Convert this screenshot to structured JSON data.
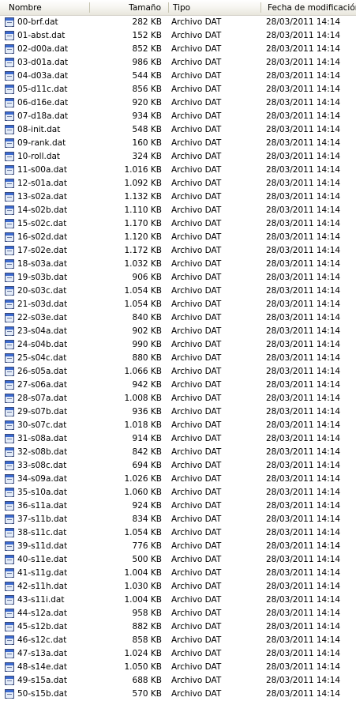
{
  "columns": {
    "name": "Nombre",
    "size": "Tamaño",
    "type": "Tipo",
    "modified": "Fecha de modificación"
  },
  "files": [
    {
      "name": "00-brf.dat",
      "size": "282 KB",
      "type": "Archivo DAT",
      "modified": "28/03/2011 14:14"
    },
    {
      "name": "01-abst.dat",
      "size": "152 KB",
      "type": "Archivo DAT",
      "modified": "28/03/2011 14:14"
    },
    {
      "name": "02-d00a.dat",
      "size": "852 KB",
      "type": "Archivo DAT",
      "modified": "28/03/2011 14:14"
    },
    {
      "name": "03-d01a.dat",
      "size": "986 KB",
      "type": "Archivo DAT",
      "modified": "28/03/2011 14:14"
    },
    {
      "name": "04-d03a.dat",
      "size": "544 KB",
      "type": "Archivo DAT",
      "modified": "28/03/2011 14:14"
    },
    {
      "name": "05-d11c.dat",
      "size": "856 KB",
      "type": "Archivo DAT",
      "modified": "28/03/2011 14:14"
    },
    {
      "name": "06-d16e.dat",
      "size": "920 KB",
      "type": "Archivo DAT",
      "modified": "28/03/2011 14:14"
    },
    {
      "name": "07-d18a.dat",
      "size": "934 KB",
      "type": "Archivo DAT",
      "modified": "28/03/2011 14:14"
    },
    {
      "name": "08-init.dat",
      "size": "548 KB",
      "type": "Archivo DAT",
      "modified": "28/03/2011 14:14"
    },
    {
      "name": "09-rank.dat",
      "size": "160 KB",
      "type": "Archivo DAT",
      "modified": "28/03/2011 14:14"
    },
    {
      "name": "10-roll.dat",
      "size": "324 KB",
      "type": "Archivo DAT",
      "modified": "28/03/2011 14:14"
    },
    {
      "name": "11-s00a.dat",
      "size": "1.016 KB",
      "type": "Archivo DAT",
      "modified": "28/03/2011 14:14"
    },
    {
      "name": "12-s01a.dat",
      "size": "1.092 KB",
      "type": "Archivo DAT",
      "modified": "28/03/2011 14:14"
    },
    {
      "name": "13-s02a.dat",
      "size": "1.132 KB",
      "type": "Archivo DAT",
      "modified": "28/03/2011 14:14"
    },
    {
      "name": "14-s02b.dat",
      "size": "1.110 KB",
      "type": "Archivo DAT",
      "modified": "28/03/2011 14:14"
    },
    {
      "name": "15-s02c.dat",
      "size": "1.170 KB",
      "type": "Archivo DAT",
      "modified": "28/03/2011 14:14"
    },
    {
      "name": "16-s02d.dat",
      "size": "1.120 KB",
      "type": "Archivo DAT",
      "modified": "28/03/2011 14:14"
    },
    {
      "name": "17-s02e.dat",
      "size": "1.172 KB",
      "type": "Archivo DAT",
      "modified": "28/03/2011 14:14"
    },
    {
      "name": "18-s03a.dat",
      "size": "1.032 KB",
      "type": "Archivo DAT",
      "modified": "28/03/2011 14:14"
    },
    {
      "name": "19-s03b.dat",
      "size": "906 KB",
      "type": "Archivo DAT",
      "modified": "28/03/2011 14:14"
    },
    {
      "name": "20-s03c.dat",
      "size": "1.054 KB",
      "type": "Archivo DAT",
      "modified": "28/03/2011 14:14"
    },
    {
      "name": "21-s03d.dat",
      "size": "1.054 KB",
      "type": "Archivo DAT",
      "modified": "28/03/2011 14:14"
    },
    {
      "name": "22-s03e.dat",
      "size": "840 KB",
      "type": "Archivo DAT",
      "modified": "28/03/2011 14:14"
    },
    {
      "name": "23-s04a.dat",
      "size": "902 KB",
      "type": "Archivo DAT",
      "modified": "28/03/2011 14:14"
    },
    {
      "name": "24-s04b.dat",
      "size": "990 KB",
      "type": "Archivo DAT",
      "modified": "28/03/2011 14:14"
    },
    {
      "name": "25-s04c.dat",
      "size": "880 KB",
      "type": "Archivo DAT",
      "modified": "28/03/2011 14:14"
    },
    {
      "name": "26-s05a.dat",
      "size": "1.066 KB",
      "type": "Archivo DAT",
      "modified": "28/03/2011 14:14"
    },
    {
      "name": "27-s06a.dat",
      "size": "942 KB",
      "type": "Archivo DAT",
      "modified": "28/03/2011 14:14"
    },
    {
      "name": "28-s07a.dat",
      "size": "1.008 KB",
      "type": "Archivo DAT",
      "modified": "28/03/2011 14:14"
    },
    {
      "name": "29-s07b.dat",
      "size": "936 KB",
      "type": "Archivo DAT",
      "modified": "28/03/2011 14:14"
    },
    {
      "name": "30-s07c.dat",
      "size": "1.018 KB",
      "type": "Archivo DAT",
      "modified": "28/03/2011 14:14"
    },
    {
      "name": "31-s08a.dat",
      "size": "914 KB",
      "type": "Archivo DAT",
      "modified": "28/03/2011 14:14"
    },
    {
      "name": "32-s08b.dat",
      "size": "842 KB",
      "type": "Archivo DAT",
      "modified": "28/03/2011 14:14"
    },
    {
      "name": "33-s08c.dat",
      "size": "694 KB",
      "type": "Archivo DAT",
      "modified": "28/03/2011 14:14"
    },
    {
      "name": "34-s09a.dat",
      "size": "1.026 KB",
      "type": "Archivo DAT",
      "modified": "28/03/2011 14:14"
    },
    {
      "name": "35-s10a.dat",
      "size": "1.060 KB",
      "type": "Archivo DAT",
      "modified": "28/03/2011 14:14"
    },
    {
      "name": "36-s11a.dat",
      "size": "924 KB",
      "type": "Archivo DAT",
      "modified": "28/03/2011 14:14"
    },
    {
      "name": "37-s11b.dat",
      "size": "834 KB",
      "type": "Archivo DAT",
      "modified": "28/03/2011 14:14"
    },
    {
      "name": "38-s11c.dat",
      "size": "1.054 KB",
      "type": "Archivo DAT",
      "modified": "28/03/2011 14:14"
    },
    {
      "name": "39-s11d.dat",
      "size": "776 KB",
      "type": "Archivo DAT",
      "modified": "28/03/2011 14:14"
    },
    {
      "name": "40-s11e.dat",
      "size": "500 KB",
      "type": "Archivo DAT",
      "modified": "28/03/2011 14:14"
    },
    {
      "name": "41-s11g.dat",
      "size": "1.004 KB",
      "type": "Archivo DAT",
      "modified": "28/03/2011 14:14"
    },
    {
      "name": "42-s11h.dat",
      "size": "1.030 KB",
      "type": "Archivo DAT",
      "modified": "28/03/2011 14:14"
    },
    {
      "name": "43-s11i.dat",
      "size": "1.004 KB",
      "type": "Archivo DAT",
      "modified": "28/03/2011 14:14"
    },
    {
      "name": "44-s12a.dat",
      "size": "958 KB",
      "type": "Archivo DAT",
      "modified": "28/03/2011 14:14"
    },
    {
      "name": "45-s12b.dat",
      "size": "882 KB",
      "type": "Archivo DAT",
      "modified": "28/03/2011 14:14"
    },
    {
      "name": "46-s12c.dat",
      "size": "858 KB",
      "type": "Archivo DAT",
      "modified": "28/03/2011 14:14"
    },
    {
      "name": "47-s13a.dat",
      "size": "1.024 KB",
      "type": "Archivo DAT",
      "modified": "28/03/2011 14:14"
    },
    {
      "name": "48-s14e.dat",
      "size": "1.050 KB",
      "type": "Archivo DAT",
      "modified": "28/03/2011 14:14"
    },
    {
      "name": "49-s15a.dat",
      "size": "688 KB",
      "type": "Archivo DAT",
      "modified": "28/03/2011 14:14"
    },
    {
      "name": "50-s15b.dat",
      "size": "570 KB",
      "type": "Archivo DAT",
      "modified": "28/03/2011 14:14"
    }
  ]
}
